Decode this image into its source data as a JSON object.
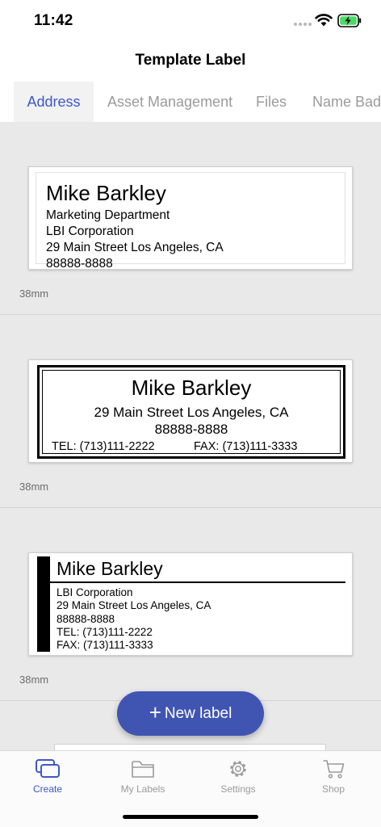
{
  "status_bar": {
    "time": "11:42"
  },
  "nav": {
    "title": "Template Label"
  },
  "tabs": [
    {
      "label": "Address",
      "active": true
    },
    {
      "label": "Asset Management",
      "active": false
    },
    {
      "label": "Files",
      "active": false
    },
    {
      "label": "Name Badg",
      "active": false
    }
  ],
  "templates": [
    {
      "size": "38mm",
      "name": "Mike Barkley",
      "lines": [
        "Marketing Department",
        "LBI Corporation",
        "29 Main Street Los Angeles, CA",
        "88888-8888"
      ]
    },
    {
      "size": "38mm",
      "name": "Mike Barkley",
      "address": "29 Main Street Los Angeles, CA",
      "zip": "88888-8888",
      "tel": "TEL: (713)111-2222",
      "fax": "FAX: (713)111-3333"
    },
    {
      "size": "38mm",
      "name": "Mike Barkley",
      "lines": [
        "LBI Corporation",
        "29 Main Street Los Angeles, CA",
        "88888-8888",
        "TEL:  (713)111-2222",
        "FAX:  (713)111-3333"
      ]
    }
  ],
  "fab": {
    "icon": "plus-icon",
    "label": "New label"
  },
  "bottom_nav": [
    {
      "label": "Create",
      "icon": "create-icon",
      "active": true
    },
    {
      "label": "My Labels",
      "icon": "folder-icon",
      "active": false
    },
    {
      "label": "Settings",
      "icon": "gear-icon",
      "active": false
    },
    {
      "label": "Shop",
      "icon": "cart-icon",
      "active": false
    }
  ],
  "colors": {
    "accent": "#3f57c7",
    "fab": "#4054b2",
    "content_bg": "#e9e9e9"
  }
}
